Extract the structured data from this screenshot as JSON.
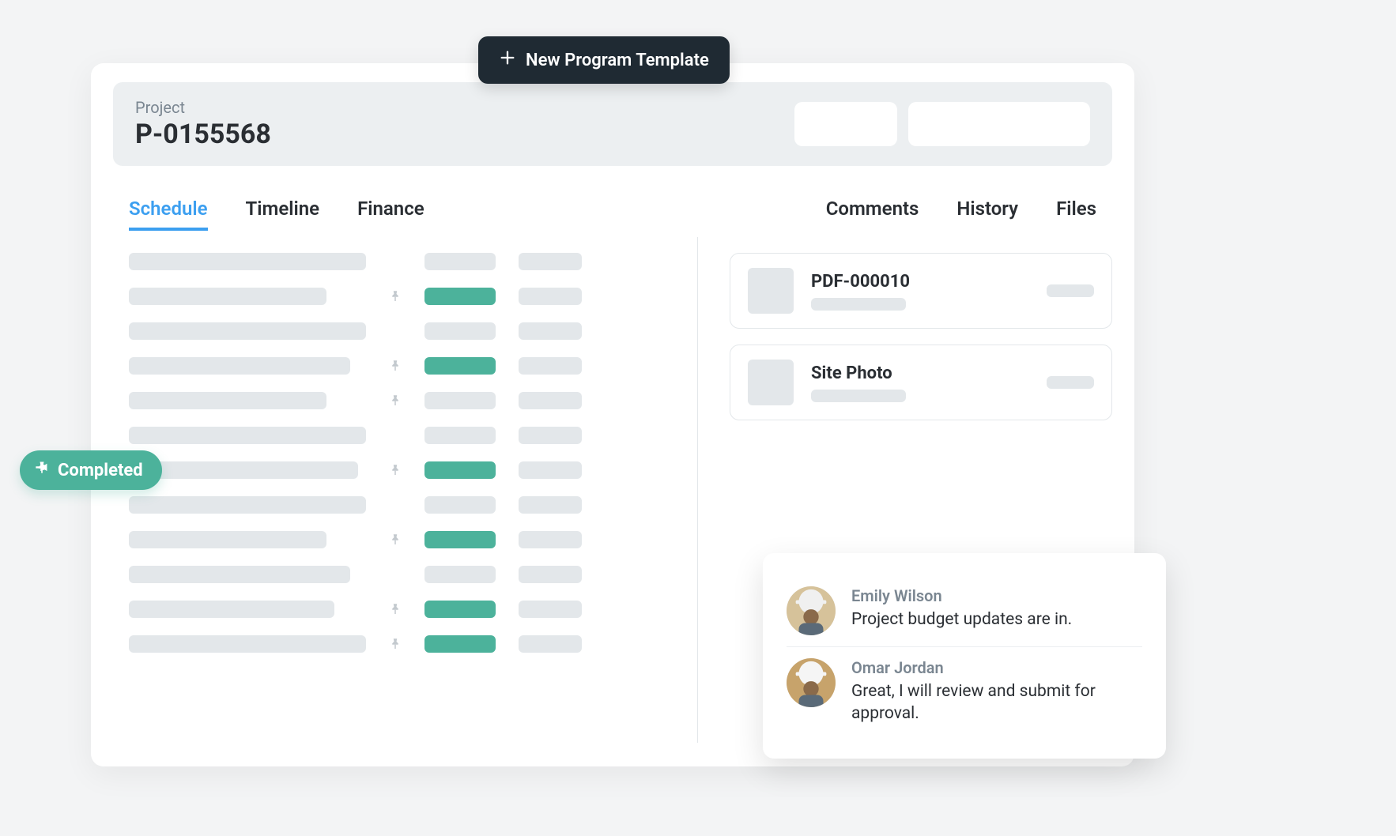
{
  "actions": {
    "new_template_label": "New Program Template"
  },
  "header": {
    "label": "Project",
    "value": "P-0155568"
  },
  "tabs_left": [
    {
      "label": "Schedule",
      "active": true
    },
    {
      "label": "Timeline",
      "active": false
    },
    {
      "label": "Finance",
      "active": false
    }
  ],
  "tabs_right": [
    {
      "label": "Comments"
    },
    {
      "label": "History"
    },
    {
      "label": "Files"
    }
  ],
  "status_pill": {
    "label": "Completed"
  },
  "schedule_rows": [
    {
      "a_w": 300,
      "pinned": false,
      "b_green": false
    },
    {
      "a_w": 250,
      "pinned": true,
      "b_green": true
    },
    {
      "a_w": 300,
      "pinned": false,
      "b_green": false
    },
    {
      "a_w": 280,
      "pinned": true,
      "b_green": true
    },
    {
      "a_w": 250,
      "pinned": true,
      "b_green": false
    },
    {
      "a_w": 300,
      "pinned": false,
      "b_green": false
    },
    {
      "a_w": 290,
      "pinned": true,
      "b_green": true
    },
    {
      "a_w": 300,
      "pinned": false,
      "b_green": false
    },
    {
      "a_w": 250,
      "pinned": true,
      "b_green": true
    },
    {
      "a_w": 280,
      "pinned": false,
      "b_green": false
    },
    {
      "a_w": 260,
      "pinned": true,
      "b_green": true
    },
    {
      "a_w": 300,
      "pinned": true,
      "b_green": true
    }
  ],
  "files": [
    {
      "title": "PDF-000010"
    },
    {
      "title": "Site Photo"
    }
  ],
  "comments": [
    {
      "name": "Emily Wilson",
      "text": "Project budget updates are in.",
      "avatar_bg": "#d6c29a",
      "hardhat": "#f0f0f0"
    },
    {
      "name": "Omar Jordan",
      "text": "Great, I will review and submit for approval.",
      "avatar_bg": "#c7a36b",
      "hardhat": "#f5f5f5"
    }
  ]
}
